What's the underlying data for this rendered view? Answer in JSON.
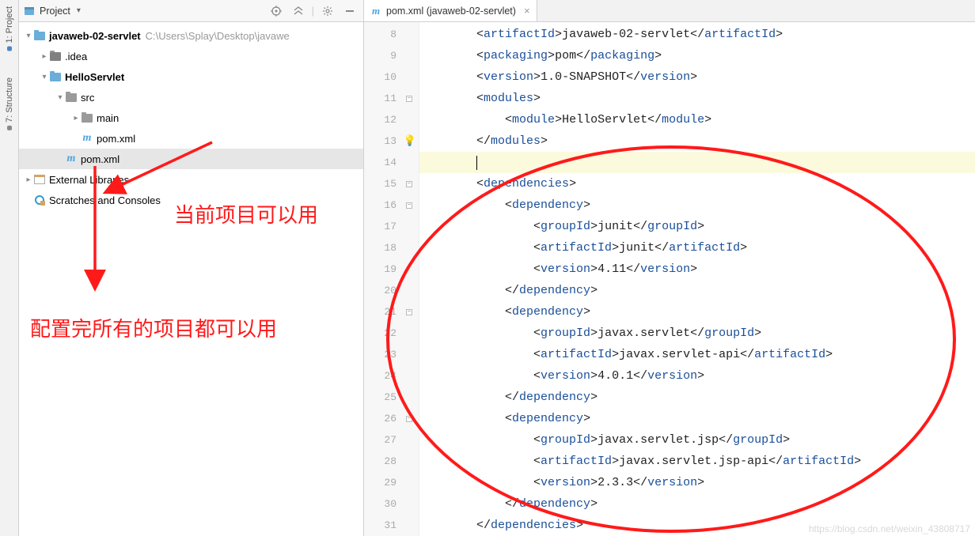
{
  "leftTabs": {
    "project": "1: Project",
    "structure": "7: Structure"
  },
  "projectPanel": {
    "title": "Project",
    "tree": {
      "root": {
        "name": "javaweb-02-servlet",
        "path": "C:\\Users\\Splay\\Desktop\\javawe"
      },
      "idea": ".idea",
      "hello": "HelloServlet",
      "src": "src",
      "main": "main",
      "pomInner": "pom.xml",
      "pomOuter": "pom.xml",
      "extLib": "External Libraries",
      "scratches": "Scratches and Consoles"
    }
  },
  "editor": {
    "tabTitle": "pom.xml (javaweb-02-servlet)",
    "gutter": [
      "8",
      "9",
      "10",
      "11",
      "12",
      "13",
      "14",
      "15",
      "16",
      "17",
      "18",
      "19",
      "20",
      "21",
      "22",
      "23",
      "24",
      "25",
      "26",
      "27",
      "28",
      "29",
      "30",
      "31"
    ],
    "code": {
      "l8_indent": "        ",
      "l8_tag1": "artifactId",
      "l8_text": "javaweb-02-servlet",
      "l9_indent": "        ",
      "l9_tag1": "packaging",
      "l9_text": "pom",
      "l10_indent": "        ",
      "l10_tag1": "version",
      "l10_text": "1.0-SNAPSHOT",
      "l11_indent": "        ",
      "l11_tag1": "modules",
      "l12_indent": "            ",
      "l12_tag1": "module",
      "l12_text": "HelloServlet",
      "l13_indent": "        ",
      "l13_tag1": "modules",
      "l14_indent": "        ",
      "l15_indent": "        ",
      "l15_tag1": "dependencies",
      "l16_indent": "            ",
      "l16_tag1": "dependency",
      "l17_indent": "                ",
      "l17_tag1": "groupId",
      "l17_text": "junit",
      "l18_indent": "                ",
      "l18_tag1": "artifactId",
      "l18_text": "junit",
      "l19_indent": "                ",
      "l19_tag1": "version",
      "l19_text": "4.11",
      "l20_indent": "            ",
      "l20_tag1": "dependency",
      "l21_indent": "            ",
      "l21_tag1": "dependency",
      "l22_indent": "                ",
      "l22_tag1": "groupId",
      "l22_text": "javax.servlet",
      "l23_indent": "                ",
      "l23_tag1": "artifactId",
      "l23_text": "javax.servlet-api",
      "l24_indent": "                ",
      "l24_tag1": "version",
      "l24_text": "4.0.1",
      "l25_indent": "            ",
      "l25_tag1": "dependency",
      "l26_indent": "            ",
      "l26_tag1": "dependency",
      "l27_indent": "                ",
      "l27_tag1": "groupId",
      "l27_text": "javax.servlet.jsp",
      "l28_indent": "                ",
      "l28_tag1": "artifactId",
      "l28_text": "javax.servlet.jsp-api",
      "l29_indent": "                ",
      "l29_tag1": "version",
      "l29_text": "2.3.3",
      "l30_indent": "            ",
      "l30_tag1": "dependency",
      "l31_indent": "        ",
      "l31_tag1": "dependencies"
    }
  },
  "annotations": {
    "text1": "当前项目可以用",
    "text2": "配置完所有的项目都可以用"
  },
  "watermark": "https://blog.csdn.net/weixin_43808717",
  "icons": {
    "m": "m"
  }
}
